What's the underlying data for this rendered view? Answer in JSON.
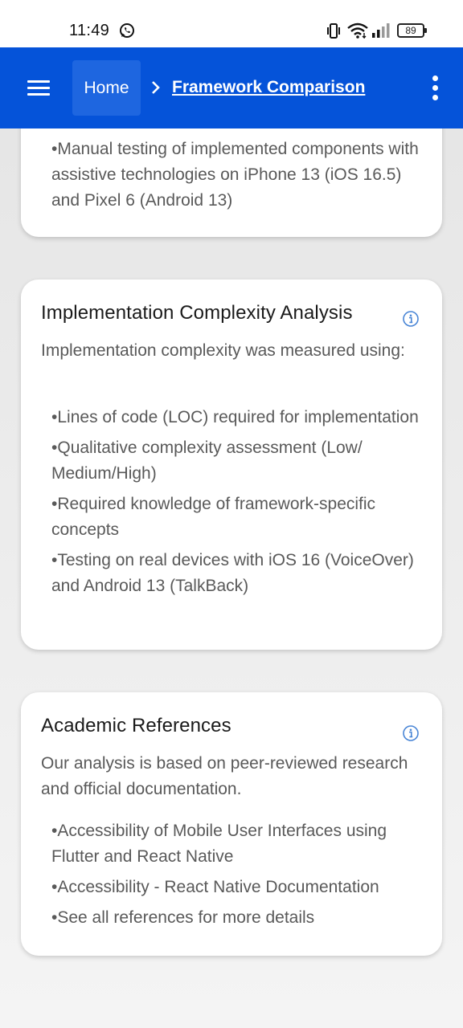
{
  "status_bar": {
    "time": "11:49",
    "battery": "89"
  },
  "app_bar": {
    "breadcrumb_home": "Home",
    "breadcrumb_current": "Framework Comparison"
  },
  "cards": [
    {
      "bullets": [
        "Manual testing of implemented components with assistive technologies on iPhone 13 (iOS 16.5) and Pixel 6 (Android 13)"
      ]
    },
    {
      "title": "Implementation Complexity Analysis",
      "intro": "Implementation complexity was measured using:",
      "bullets": [
        "Lines of code (LOC) required for implementation",
        "Qualitative complexity assessment (Low/ Medium/High)",
        "Required knowledge of framework-specific concepts",
        "Testing on real devices with iOS 16 (VoiceOver) and Android 13 (TalkBack)"
      ]
    },
    {
      "title": "Academic References",
      "intro": "Our analysis is based on peer-reviewed research and official documentation.",
      "bullets": [
        "Accessibility of Mobile User Interfaces using Flutter and React Native",
        "Accessibility - React Native Documentation",
        "See all references for more details"
      ]
    }
  ],
  "icons": {
    "menu": "hamburger-menu-icon",
    "more": "more-vertical-icon",
    "info": "info-icon",
    "breadcrumb_separator": "chevron-right-icon"
  },
  "colors": {
    "app_bar": "#0553d9",
    "home_crumb": "#1e66e0",
    "info_icon": "#4a86d6",
    "body_text": "#595959"
  }
}
